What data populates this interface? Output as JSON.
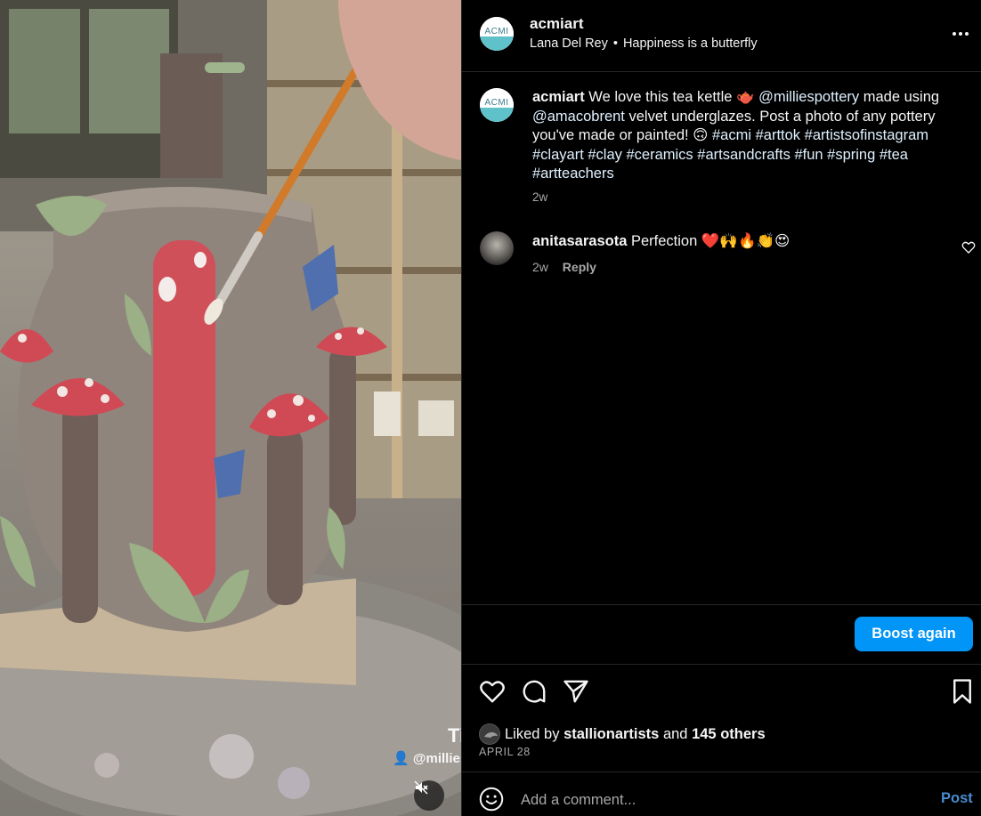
{
  "post": {
    "username": "acmiart",
    "audio_artist": "Lana Del Rey",
    "audio_separator": "•",
    "audio_title": "Happiness is a butterfly",
    "avatar_text": "ACMI",
    "more_icon": "more-horizontal-icon"
  },
  "caption": {
    "username": "acmiart",
    "part1": "We love this tea kettle 🫖",
    "mention1": "@milliespottery",
    "part2": "made using",
    "mention2": "@amacobrent",
    "part3": "velvet underglazes. Post a photo of any pottery you've made or painted! 🙃",
    "hashtags": [
      "#acmi",
      "#arttok",
      "#artistsofinstagram",
      "#clayart",
      "#clay",
      "#ceramics",
      "#artsandcrafts",
      "#fun",
      "#spring",
      "#tea",
      "#artteachers"
    ],
    "time": "2w"
  },
  "comments": [
    {
      "username": "anitasarasota",
      "text": "Perfection ❤️🙌🔥👏😍",
      "time": "2w",
      "reply_label": "Reply"
    }
  ],
  "actions": {
    "boost_label": "Boost again",
    "like_icon": "heart-icon",
    "comment_icon": "comment-icon",
    "share_icon": "send-icon",
    "save_icon": "bookmark-icon"
  },
  "likes": {
    "prefix": "Liked by",
    "user": "stallionartists",
    "and": "and",
    "others": "145 others"
  },
  "date": "APRIL 28",
  "comment_box": {
    "placeholder": "Add a comment...",
    "post_label": "Post",
    "emoji_icon": "emoji-icon"
  },
  "media": {
    "watermark_big": "Ti",
    "watermark_handle": "@millies",
    "mute_icon": "muted-speaker-icon"
  },
  "colors": {
    "accent": "#0095f6",
    "link": "#e0f1ff",
    "secondary_text": "#a8a8a8",
    "border": "#262626"
  }
}
